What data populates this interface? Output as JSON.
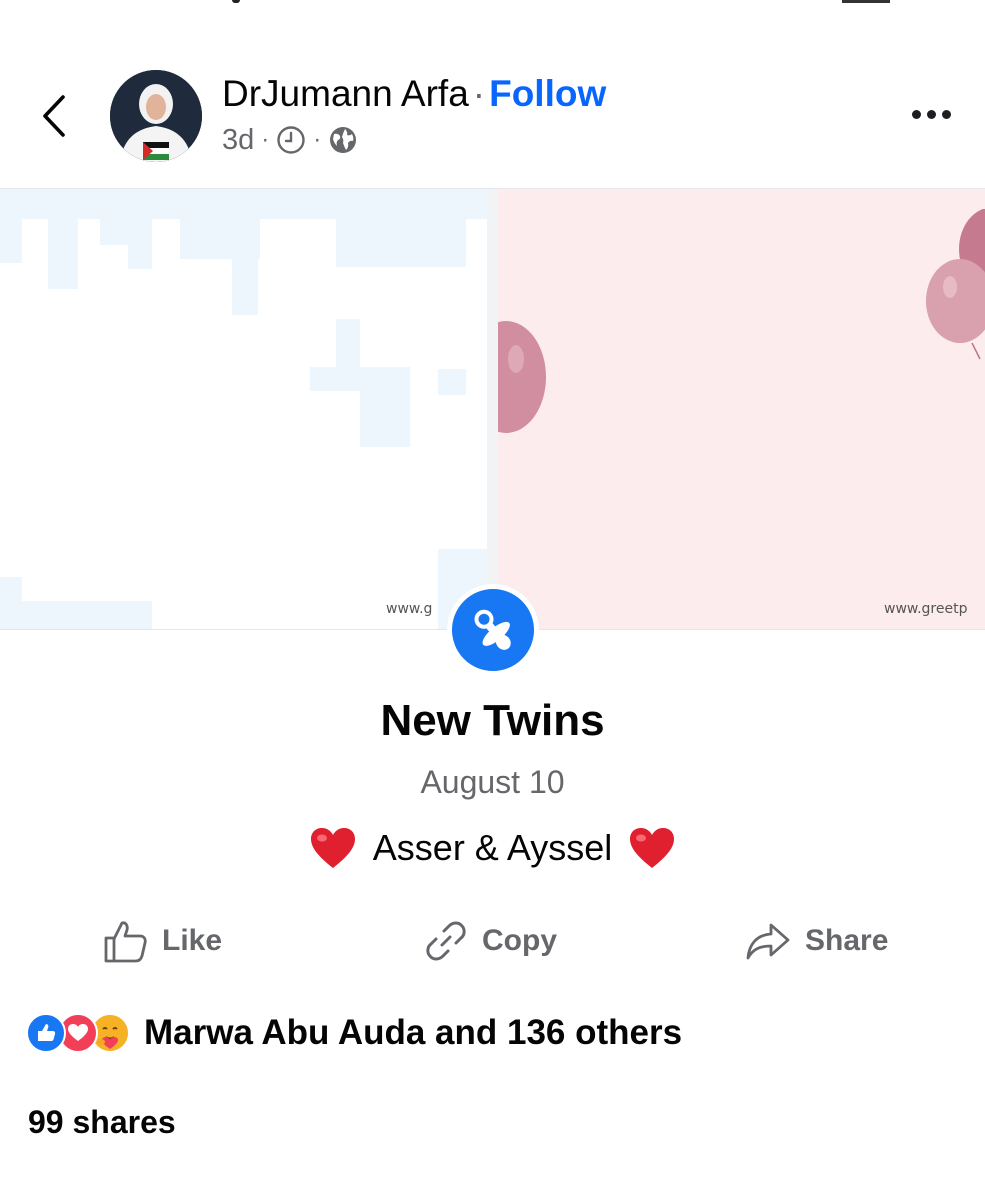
{
  "post": {
    "author_name": "DrJumann Arfa",
    "separator": "·",
    "follow_label": "Follow",
    "time_ago": "3d",
    "meta_dot": "·"
  },
  "cover": {
    "watermark_left": "www.g",
    "watermark_right": "www.greetp",
    "colors": {
      "left_bg": "#ffffff",
      "right_bg": "#fdeced",
      "balloon": "#d08ea0"
    }
  },
  "life_event": {
    "icon": "pacifier-icon",
    "title": "New Twins",
    "date": "August 10",
    "caption_text": "Asser & Ayssel"
  },
  "actions": [
    {
      "label": "Like",
      "icon": "thumbs-up-icon"
    },
    {
      "label": "Copy",
      "icon": "link-icon"
    },
    {
      "label": "Share",
      "icon": "share-arrow-icon"
    }
  ],
  "reactions": {
    "icons": [
      "like-reaction-icon",
      "love-reaction-icon",
      "care-reaction-icon"
    ],
    "summary": "Marwa Abu Auda and 136 others"
  },
  "shares": "99 shares",
  "colors": {
    "accent": "#0866ff",
    "badge": "#1877f2",
    "secondary_text": "#65676b",
    "heart": "#e0202f"
  }
}
